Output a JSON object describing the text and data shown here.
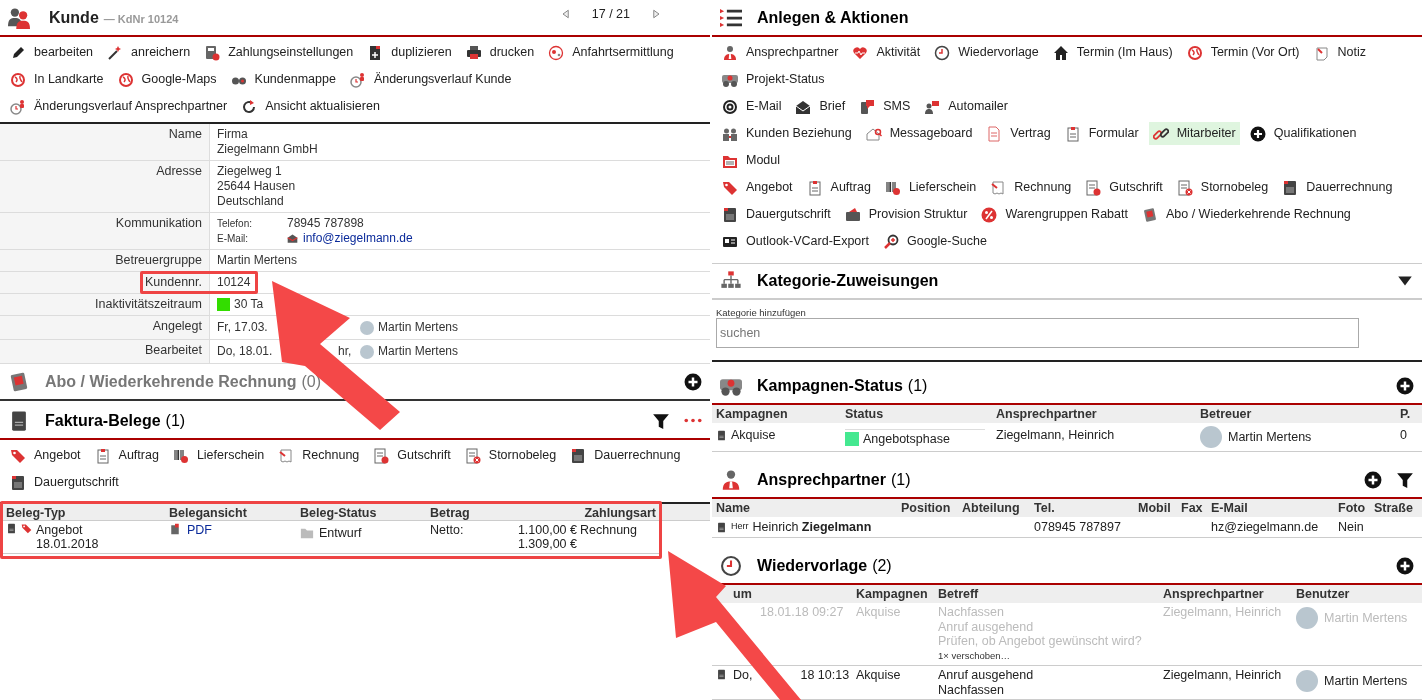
{
  "customer": {
    "title": "Kunde",
    "subtitle": "— KdNr 10124",
    "pager": "17 / 21",
    "actions": [
      [
        {
          "label": "bearbeiten"
        },
        {
          "label": "anreichern"
        },
        {
          "label": "Zahlungseinstellungen"
        },
        {
          "label": "duplizieren"
        },
        {
          "label": "drucken"
        },
        {
          "label": "Anfahrtsermittlung"
        }
      ],
      [
        {
          "label": "In Landkarte"
        },
        {
          "label": "Google-Maps"
        },
        {
          "label": "Kundenmappe"
        },
        {
          "label": "Änderungsverlauf Kunde"
        }
      ],
      [
        {
          "label": "Änderungsverlauf Ansprechpartner"
        },
        {
          "label": "Ansicht aktualisieren"
        }
      ]
    ],
    "details": [
      {
        "kind": "lines",
        "label": "Name",
        "lines": [
          "Firma",
          "Ziegelmann GmbH"
        ],
        "highlighted": false
      },
      {
        "kind": "lines",
        "label": "Adresse",
        "lines": [
          "Ziegelweg 1",
          "25644 Hausen",
          "Deutschland"
        ],
        "highlighted": false
      },
      {
        "kind": "contact",
        "label": "Kommunikation",
        "entries": [
          {
            "label": "Telefon:",
            "value": "78945 787898",
            "link": false
          },
          {
            "label": "E-Mail:",
            "value": "info@ziegelmann.de",
            "link": true
          }
        ],
        "highlighted": false
      },
      {
        "kind": "lines",
        "label": "Betreuergruppe",
        "lines": [
          "Martin Mertens"
        ],
        "highlighted": false
      },
      {
        "kind": "lines",
        "label": "Kundennr.",
        "lines": [
          "10124"
        ],
        "highlighted": true
      },
      {
        "kind": "status",
        "label": "Inaktivitätszeitraum",
        "color": "#33dd00",
        "text": "30 Ta",
        "highlighted": false
      },
      {
        "kind": "audit",
        "label": "Angelegt",
        "parts": [
          "Fr, 17.03."
        ],
        "user": "Martin Mertens",
        "highlighted": false
      },
      {
        "kind": "audit",
        "label": "Bearbeitet",
        "parts": [
          "Do, 18.01.",
          "hr,"
        ],
        "user": "Martin Mertens",
        "highlighted": false
      }
    ]
  },
  "subscriptions": {
    "title": "Abo / Wiederkehrende Rechnung",
    "count": "(0)",
    "disabled": true
  },
  "invoices": {
    "title": "Faktura-Belege",
    "count": "(1)",
    "highlighted": true,
    "actions": [
      [
        {
          "label": "Angebot"
        },
        {
          "label": "Auftrag"
        },
        {
          "label": "Lieferschein"
        },
        {
          "label": "Rechnung"
        },
        {
          "label": "Gutschrift"
        },
        {
          "label": "Stornobeleg"
        },
        {
          "label": "Dauerrechnung"
        }
      ],
      [
        {
          "label": "Dauergutschrift"
        }
      ]
    ],
    "columns": [
      "Beleg-Typ",
      "Belegansicht",
      "Beleg-Status",
      "Betrag",
      "Zahlungsart"
    ],
    "rows": [
      {
        "type": "Angebot",
        "date": "18.01.2018",
        "view": "PDF",
        "status": "Entwurf",
        "amount_label": "Netto:",
        "amounts": [
          "1.100,00 €",
          "1.309,00 €"
        ],
        "payment": "Rechnung"
      }
    ]
  },
  "create_actions": {
    "title": "Anlegen & Aktionen",
    "groups": [
      {
        "items": [
          {
            "label": "Ansprechpartner",
            "selected": false
          },
          {
            "label": "Aktivität",
            "selected": false
          },
          {
            "label": "Wiedervorlage",
            "selected": false
          },
          {
            "label": "Termin (Im Haus)",
            "selected": false
          },
          {
            "label": "Termin (Vor Ort)",
            "selected": false
          },
          {
            "label": "Notiz",
            "selected": false
          },
          {
            "label": "Projekt-Status",
            "selected": false
          }
        ]
      },
      {
        "items": [
          {
            "label": "E-Mail",
            "selected": false
          },
          {
            "label": "Brief",
            "selected": false
          },
          {
            "label": "SMS",
            "selected": false
          },
          {
            "label": "Automailer",
            "selected": false
          }
        ]
      },
      {
        "items": [
          {
            "label": "Kunden Beziehung",
            "selected": false
          },
          {
            "label": "Messageboard",
            "selected": false
          },
          {
            "label": "Vertrag",
            "selected": false
          },
          {
            "label": "Formular",
            "selected": false
          },
          {
            "label": "Mitarbeiter",
            "selected": true
          },
          {
            "label": "Qualifikationen",
            "selected": false
          },
          {
            "label": "Modul",
            "selected": false
          }
        ]
      },
      {
        "items": [
          {
            "label": "Angebot",
            "selected": false
          },
          {
            "label": "Auftrag",
            "selected": false
          },
          {
            "label": "Lieferschein",
            "selected": false
          },
          {
            "label": "Rechnung",
            "selected": false
          },
          {
            "label": "Gutschrift",
            "selected": false
          },
          {
            "label": "Stornobeleg",
            "selected": false
          },
          {
            "label": "Dauerrechnung",
            "selected": false
          },
          {
            "label": "Dauergutschrift",
            "selected": false
          },
          {
            "label": "Provision Struktur",
            "selected": false
          },
          {
            "label": "Warengruppen Rabatt",
            "selected": false
          },
          {
            "label": "Abo / Wiederkehrende Rechnung",
            "selected": false
          },
          {
            "label": "Outlook-VCard-Export",
            "selected": false
          },
          {
            "label": "Google-Suche",
            "selected": false
          }
        ]
      }
    ]
  },
  "categories": {
    "title": "Kategorie-Zuweisungen",
    "field_label": "Kategorie hinzufügen",
    "placeholder": "suchen"
  },
  "campaigns": {
    "title": "Kampagnen-Status",
    "count": "(1)",
    "columns": [
      "Kampagnen",
      "Status",
      "Ansprechpartner",
      "Betreuer",
      "P."
    ],
    "rows": [
      {
        "campaign": "Akquise",
        "status": "Angebotsphase",
        "color": "#44e890",
        "contact": "Ziegelmann, Heinrich",
        "user": "Martin Mertens",
        "p": "0"
      }
    ]
  },
  "contacts": {
    "title": "Ansprechpartner",
    "count": "(1)",
    "columns": [
      "Name",
      "Position",
      "Abteilung",
      "Tel.",
      "Mobil",
      "Fax",
      "E-Mail",
      "Foto",
      "Straße"
    ],
    "rows": [
      {
        "salutation": "Herr",
        "name": "Heinrich **Ziegelmann**",
        "tel": "078945 787897",
        "email": "hz@ziegelmann.de",
        "photo": "Nein"
      }
    ]
  },
  "followups": {
    "title": "Wiedervorlage",
    "count": "(2)",
    "columns": [
      "um",
      "Kampagnen",
      "Betreff",
      "Ansprechpartner",
      "Benutzer"
    ],
    "rows": [
      {
        "done": true,
        "date": [
          "18.01.18 09:27"
        ],
        "campaign": "Akquise",
        "subject": [
          "Nachfassen",
          "Anruf ausgehend",
          "Prüfen, ob Angebot gewünscht wird?"
        ],
        "note": "1× verschoben…",
        "contact": "Ziegelmann, Heinrich",
        "user": "Martin Mertens"
      },
      {
        "done": false,
        "date": [
          "Do,",
          "18 10:13"
        ],
        "campaign": "Akquise",
        "subject": [
          "Anruf ausgehend",
          "Nachfassen"
        ],
        "contact": "Ziegelmann, Heinrich",
        "user": "Martin Mertens"
      }
    ]
  }
}
